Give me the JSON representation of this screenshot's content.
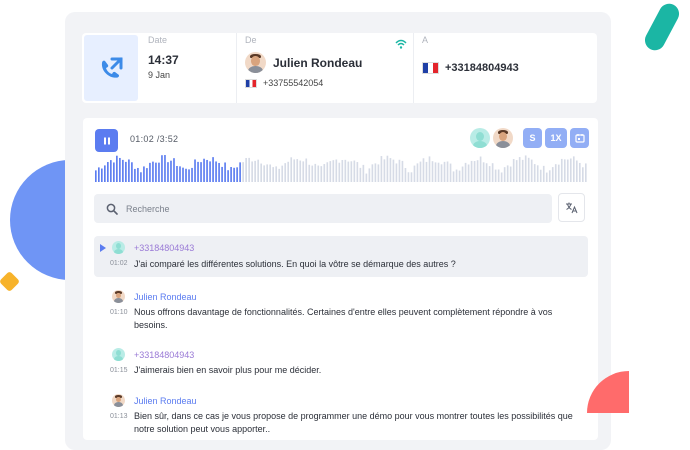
{
  "header": {
    "date_label": "Date",
    "time": "14:37",
    "date": "9 Jan",
    "from_label": "De",
    "from_name": "Julien Rondeau",
    "from_number": "+33755542054",
    "to_label": "A",
    "to_number": "+33184804943"
  },
  "player": {
    "time": "01:02 /3:52",
    "progress": 0.3,
    "controls": {
      "speaker": "S",
      "speed": "1X"
    }
  },
  "search": {
    "placeholder": "Recherche"
  },
  "messages": [
    {
      "speaker": "+33184804943",
      "time": "01:02",
      "text": "J'ai comparé les différentes solutions. En quoi la vôtre se démarque des autres ?"
    },
    {
      "speaker": "Julien Rondeau",
      "time": "01:10",
      "text": "Nous offrons davantage de fonctionnalités. Certaines d'entre elles peuvent complètement répondre à vos besoins."
    },
    {
      "speaker": "+33184804943",
      "time": "01:15",
      "text": "J'aimerais bien en savoir plus pour me décider."
    },
    {
      "speaker": "Julien Rondeau",
      "time": "01:13",
      "text": "Bien sûr, dans ce cas je vous propose de programmer une démo pour vous montrer toutes les possibilités que notre solution peut vous apporter.."
    }
  ],
  "colors": {
    "accent": "#5b7cf0",
    "customer": "#9a7ad6",
    "teal": "#1bb6a4",
    "decor_blue": "#6f95f5",
    "decor_red": "#ff6b6b",
    "decor_yellow": "#f7b32b"
  },
  "icons": [
    "call-outgoing-icon",
    "wifi-icon",
    "pause-icon",
    "search-icon",
    "translate-icon",
    "calendar-icon",
    "play-icon"
  ]
}
